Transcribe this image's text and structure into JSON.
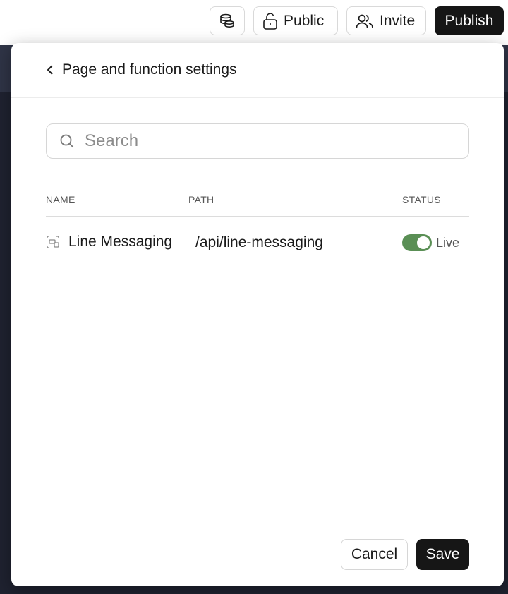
{
  "topbar": {
    "db_icon": "database-icon",
    "public_label": "Public",
    "public_icon": "unlock-icon",
    "invite_label": "Invite",
    "invite_icon": "users-icon",
    "publish_label": "Publish"
  },
  "modal": {
    "title": "Page and function settings",
    "back_icon": "chevron-left-icon",
    "search": {
      "placeholder": "Search",
      "value": "",
      "icon": "search-icon"
    },
    "table": {
      "headers": [
        "NAME",
        "PATH",
        "STATUS"
      ],
      "rows": [
        {
          "icon": "function-icon",
          "name": "Line Messaging",
          "path": "/api/line-messaging",
          "status": "Live",
          "enabled": true
        }
      ]
    },
    "footer": {
      "cancel_label": "Cancel",
      "save_label": "Save"
    }
  },
  "colors": {
    "toggle_on": "#5a8f55",
    "primary": "#161616",
    "backdrop": "#1f2230"
  }
}
